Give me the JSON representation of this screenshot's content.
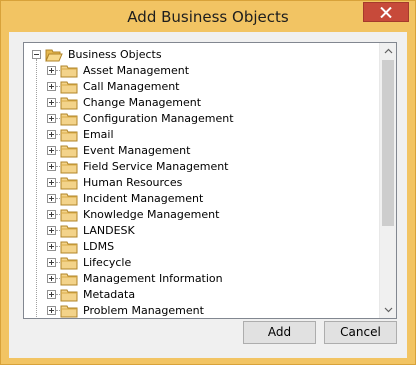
{
  "dialog": {
    "title": "Add Business Objects"
  },
  "tree": {
    "root_label": "Business Objects",
    "items": [
      {
        "label": "Asset Management"
      },
      {
        "label": "Call Management"
      },
      {
        "label": "Change Management"
      },
      {
        "label": "Configuration Management"
      },
      {
        "label": "Email"
      },
      {
        "label": "Event Management"
      },
      {
        "label": "Field Service Management"
      },
      {
        "label": "Human Resources"
      },
      {
        "label": "Incident Management"
      },
      {
        "label": "Knowledge Management"
      },
      {
        "label": "LANDESK"
      },
      {
        "label": "LDMS"
      },
      {
        "label": "Lifecycle"
      },
      {
        "label": "Management Information"
      },
      {
        "label": "Metadata"
      },
      {
        "label": "Problem Management"
      }
    ]
  },
  "buttons": {
    "add_label": "Add",
    "cancel_label": "Cancel"
  },
  "colors": {
    "title_bar": "#f2c463",
    "close_button": "#c74a3a",
    "folder": "#f3d38a"
  },
  "icons": [
    "close-icon",
    "folder-open-icon",
    "folder-icon",
    "expand-plus-icon",
    "collapse-minus-icon",
    "scroll-up-icon",
    "scroll-down-icon"
  ]
}
